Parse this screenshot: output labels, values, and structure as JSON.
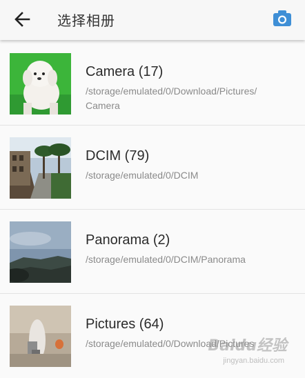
{
  "appbar": {
    "back_icon": "arrow-left-icon",
    "title": "选择相册",
    "camera_icon": "camera-icon",
    "accent": "#3f8fd6"
  },
  "albums": [
    {
      "name": "Camera (17)",
      "path": "/storage/emulated/0/Download/Pictures/\nCamera",
      "thumb": "white-poodle-green-background"
    },
    {
      "name": "DCIM (79)",
      "path": "/storage/emulated/0/DCIM",
      "thumb": "palm-tree-courtyard"
    },
    {
      "name": "Panorama (2)",
      "path": "/storage/emulated/0/DCIM/Panorama",
      "thumb": "coastal-sky-panorama"
    },
    {
      "name": "Pictures (64)",
      "path": "/storage/emulated/0/Download/Pictures",
      "thumb": "blurred-room-photo"
    }
  ],
  "watermark": {
    "text": "Baidu经验",
    "sub": "jingyan.baidu.com"
  }
}
